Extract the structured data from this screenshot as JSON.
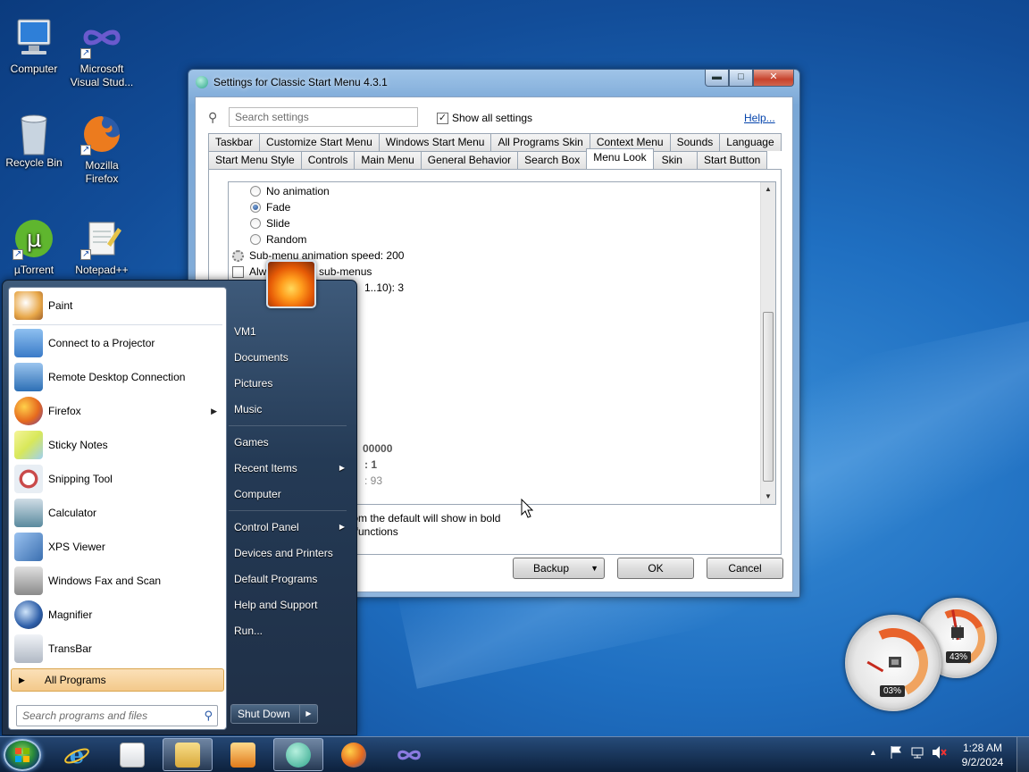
{
  "desktop": {
    "icons": [
      {
        "label": "Computer"
      },
      {
        "label": "Microsoft Visual Stud..."
      },
      {
        "label": "Recycle Bin"
      },
      {
        "label": "Mozilla Firefox"
      },
      {
        "label": "µTorrent"
      },
      {
        "label": "Notepad++"
      }
    ]
  },
  "window": {
    "title": "Settings for Classic Start Menu 4.3.1",
    "controls": {
      "minimize": "▬",
      "maximize": "□",
      "close": "✕"
    },
    "search_placeholder": "Search settings",
    "show_all_settings_label": "Show all settings",
    "show_all_checked": "✓",
    "help_label": "Help...",
    "tabs_row1": [
      "Taskbar",
      "Customize Start Menu",
      "Windows Start Menu",
      "All Programs Skin",
      "Context Menu",
      "Sounds",
      "Language"
    ],
    "tabs_row2": [
      "Start Menu Style",
      "Controls",
      "Main Menu",
      "General Behavior",
      "Search Box",
      "Menu Look",
      "Skin",
      "Start Button"
    ],
    "active_tab": "Menu Look",
    "settings": {
      "radio_no_animation": "No animation",
      "radio_fade": "Fade",
      "radio_slide": "Slide",
      "radio_random": "Random",
      "submenu_speed": "Sub-menu animation speed: 200",
      "always_prefix": "Alwa",
      "always_suffix": "sub-menus",
      "partial_range": "1..10): 3",
      "partial_1": "00000",
      "partial_2": ": 1",
      "partial_3": ": 93"
    },
    "note_default": "d from the default will show in bold",
    "note_more": "ore functions",
    "buttons": {
      "backup": "Backup",
      "ok": "OK",
      "cancel": "Cancel"
    }
  },
  "start_menu": {
    "programs": [
      {
        "label": "Paint",
        "color": "#e8a84a"
      },
      {
        "label": "Connect to a Projector",
        "color": "#3a7bc8"
      },
      {
        "label": "Remote Desktop Connection",
        "color": "#2d6fb5"
      },
      {
        "label": "Firefox",
        "color": "#e66a1e",
        "has_arrow": true
      },
      {
        "label": "Sticky Notes",
        "color": "#d8e85a"
      },
      {
        "label": "Snipping Tool",
        "color": "#c94a4a"
      },
      {
        "label": "Calculator",
        "color": "#5a8a9e"
      },
      {
        "label": "XPS Viewer",
        "color": "#3b6fb0"
      },
      {
        "label": "Windows Fax and Scan",
        "color": "#8a8a8a"
      },
      {
        "label": "Magnifier",
        "color": "#2d5ea8"
      },
      {
        "label": "TransBar",
        "color": "#b0b8c4"
      }
    ],
    "all_programs": "All Programs",
    "search_placeholder": "Search programs and files",
    "right_items": [
      "VM1",
      "Documents",
      "Pictures",
      "Music",
      "Games",
      "Recent Items",
      "Computer",
      "Control Panel",
      "Devices and Printers",
      "Default Programs",
      "Help and Support",
      "Run..."
    ],
    "shut_down": "Shut Down"
  },
  "gadgets": {
    "cpu_percent": "03%",
    "memory_percent": "43%"
  },
  "taskbar": {
    "clock_time": "1:28 AM",
    "clock_date": "9/2/2024",
    "tray_arrow": "▲"
  }
}
